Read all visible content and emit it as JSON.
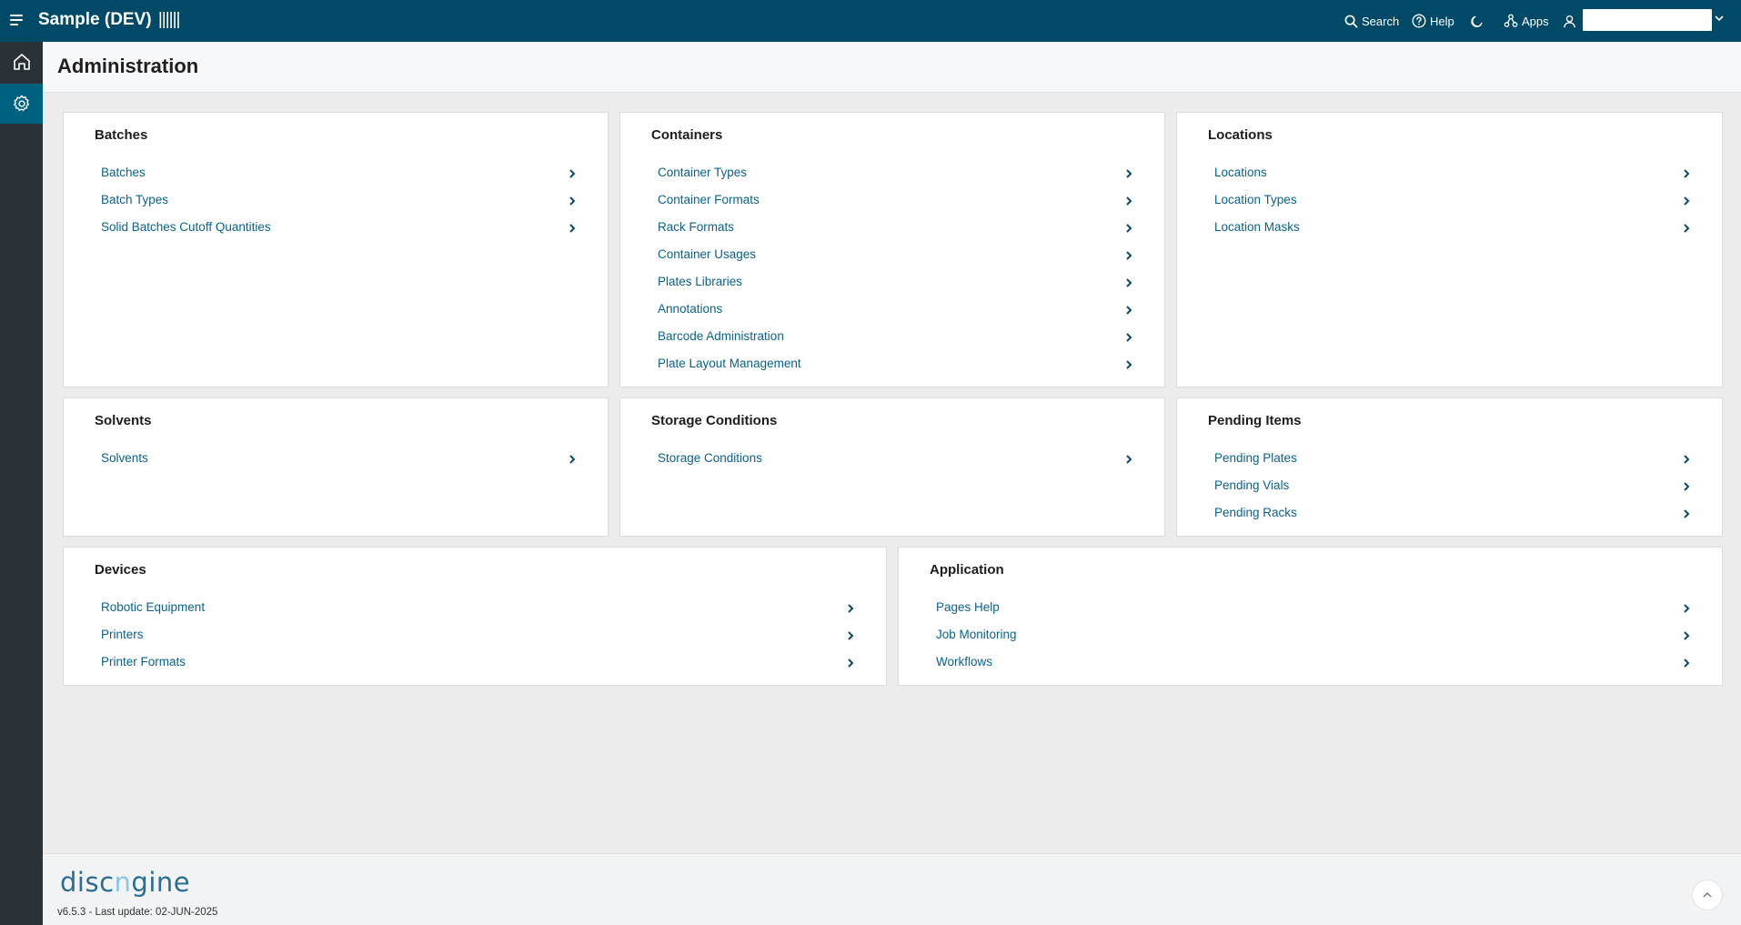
{
  "app": {
    "title": "Sample (DEV)",
    "title_code": "||||||"
  },
  "topbar": {
    "search_label": "Search",
    "help_label": "Help",
    "apps_label": "Apps"
  },
  "page": {
    "title": "Administration"
  },
  "cards": {
    "batches": {
      "title": "Batches",
      "items": [
        "Batches",
        "Batch Types",
        "Solid Batches Cutoff Quantities"
      ]
    },
    "containers": {
      "title": "Containers",
      "items": [
        "Container Types",
        "Container Formats",
        "Rack Formats",
        "Container Usages",
        "Plates Libraries",
        "Annotations",
        "Barcode Administration",
        "Plate Layout Management"
      ]
    },
    "locations": {
      "title": "Locations",
      "items": [
        "Locations",
        "Location Types",
        "Location Masks"
      ]
    },
    "solvents": {
      "title": "Solvents",
      "items": [
        "Solvents"
      ]
    },
    "storage": {
      "title": "Storage Conditions",
      "items": [
        "Storage Conditions"
      ]
    },
    "pending": {
      "title": "Pending Items",
      "items": [
        "Pending Plates",
        "Pending Vials",
        "Pending Racks"
      ]
    },
    "devices": {
      "title": "Devices",
      "items": [
        "Robotic Equipment",
        "Printers",
        "Printer Formats"
      ]
    },
    "application": {
      "title": "Application",
      "items": [
        "Pages Help",
        "Job Monitoring",
        "Workflows"
      ]
    }
  },
  "footer": {
    "logo_a": "disc",
    "logo_n": "n",
    "logo_b": "gine",
    "version": "v6.5.3 - Last update: 02-JUN-2025"
  },
  "colors": {
    "topbar": "#004a68",
    "sidebar": "#2b3237",
    "sidebar_active": "#00607f",
    "link": "#0a628b"
  }
}
